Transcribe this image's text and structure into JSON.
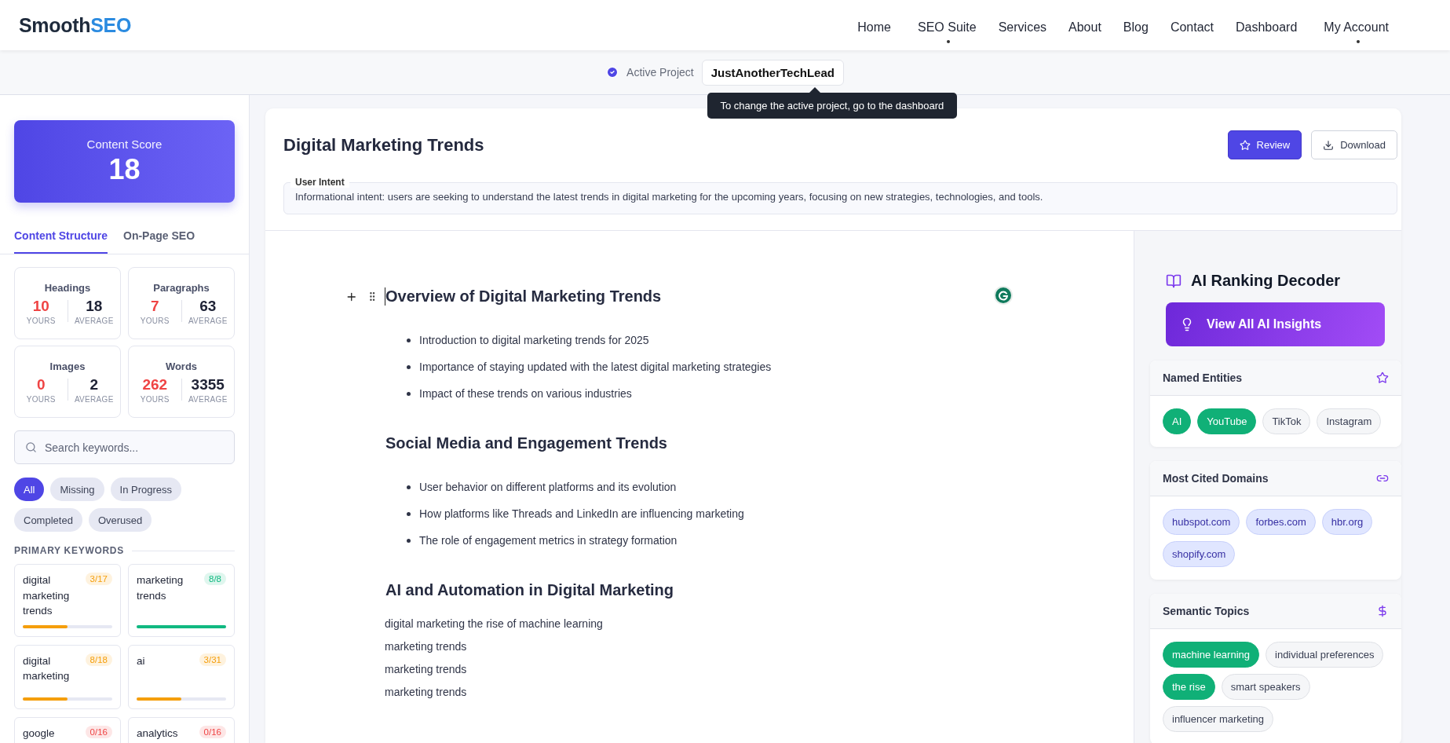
{
  "brand": {
    "main": "Smooth",
    "accent": "SEO"
  },
  "nav": [
    {
      "label": "Home",
      "dropdown": false
    },
    {
      "label": "SEO Suite",
      "dropdown": true
    },
    {
      "label": "Services",
      "dropdown": false
    },
    {
      "label": "About",
      "dropdown": false
    },
    {
      "label": "Blog",
      "dropdown": false
    },
    {
      "label": "Contact",
      "dropdown": false
    },
    {
      "label": "Dashboard",
      "dropdown": false
    },
    {
      "label": "My Account",
      "dropdown": true
    }
  ],
  "project": {
    "label": "Active Project",
    "checked": true,
    "name": "JustAnotherTechLead",
    "tooltip": "To change the active project, go to the dashboard"
  },
  "score": {
    "label": "Content Score",
    "value": "18"
  },
  "tabs": [
    {
      "label": "Content Structure",
      "selected": true
    },
    {
      "label": "On-Page SEO",
      "selected": false
    }
  ],
  "stats": [
    {
      "title": "Headings",
      "yours": "10",
      "average": "18",
      "yours_label": "YOURS",
      "average_label": "AVERAGE"
    },
    {
      "title": "Paragraphs",
      "yours": "7",
      "average": "63",
      "yours_label": "YOURS",
      "average_label": "AVERAGE"
    },
    {
      "title": "Images",
      "yours": "0",
      "average": "2",
      "yours_label": "YOURS",
      "average_label": "AVERAGE"
    },
    {
      "title": "Words",
      "yours": "262",
      "average": "3355",
      "yours_label": "YOURS",
      "average_label": "AVERAGE"
    }
  ],
  "search": {
    "placeholder": "Search keywords..."
  },
  "filters": [
    {
      "label": "All",
      "selected": true
    },
    {
      "label": "Missing",
      "selected": false
    },
    {
      "label": "In Progress",
      "selected": false
    },
    {
      "label": "Completed",
      "selected": false
    },
    {
      "label": "Overused",
      "selected": false
    }
  ],
  "keywords_title": "PRIMARY KEYWORDS",
  "keywords": [
    {
      "term": "digital marketing trends",
      "count": "3/17",
      "color": "#f59e0b",
      "level": 0.5
    },
    {
      "term": "marketing trends",
      "count": "8/8",
      "color": "#10b981",
      "level": 1
    },
    {
      "term": "digital marketing",
      "count": "8/18",
      "color": "#f59e0b",
      "level": 0.5
    },
    {
      "term": "ai",
      "count": "3/31",
      "color": "#f59e0b",
      "level": 0.5
    },
    {
      "term": "google",
      "count": "0/16",
      "color": "#ef4444"
    },
    {
      "term": "analytics",
      "count": "0/16",
      "color": "#ef4444"
    }
  ],
  "document": {
    "title": "Digital Marketing Trends",
    "actions": [
      {
        "label": "Review",
        "kind": "primary"
      },
      {
        "label": "Download",
        "kind": "secondary"
      }
    ],
    "intent_label": "User Intent",
    "intent": "Informational intent: users are seeking to understand the latest trends in digital marketing for the upcoming years, focusing on new strategies, technologies, and tools."
  },
  "editor": [
    {
      "kind": "heading",
      "text": "Overview of Digital Marketing Trends",
      "focused": true
    },
    {
      "kind": "bullets",
      "items": [
        "Introduction to digital marketing trends for 2025",
        "Importance of staying updated with the latest digital marketing strategies",
        "Impact of these trends on various industries"
      ]
    },
    {
      "kind": "heading",
      "text": "Social Media and Engagement Trends",
      "focused": false
    },
    {
      "kind": "bullets",
      "items": [
        "User behavior on different platforms and its evolution",
        "How platforms like Threads and LinkedIn are influencing marketing",
        "The role of engagement metrics in strategy formation"
      ]
    },
    {
      "kind": "heading",
      "text": "AI and Automation in Digital Marketing",
      "focused": false
    },
    {
      "kind": "paragraph",
      "text": "digital marketing the rise of machine learning"
    },
    {
      "kind": "paragraph",
      "text": "marketing trends"
    },
    {
      "kind": "paragraph",
      "text": "marketing trends"
    },
    {
      "kind": "paragraph",
      "text": "marketing trends"
    }
  ],
  "decoder": {
    "title": "AI Ranking Decoder",
    "button": "View All AI Insights",
    "sections": [
      {
        "title": "Named Entities",
        "kind": "toggle",
        "chips": [
          {
            "label": "AI",
            "selected": true
          },
          {
            "label": "YouTube",
            "selected": true
          },
          {
            "label": "TikTok",
            "selected": false
          },
          {
            "label": "Instagram",
            "selected": false
          }
        ]
      },
      {
        "title": "Most Cited Domains",
        "kind": "domain",
        "chips": [
          {
            "label": "hubspot.com"
          },
          {
            "label": "forbes.com"
          },
          {
            "label": "hbr.org"
          },
          {
            "label": "shopify.com"
          }
        ]
      },
      {
        "title": "Semantic Topics",
        "kind": "toggle",
        "chips": [
          {
            "label": "machine learning",
            "selected": true
          },
          {
            "label": "individual preferences",
            "selected": false
          },
          {
            "label": "the rise",
            "selected": true
          },
          {
            "label": "smart speakers",
            "selected": false
          },
          {
            "label": "influencer marketing",
            "selected": false
          }
        ]
      }
    ]
  }
}
